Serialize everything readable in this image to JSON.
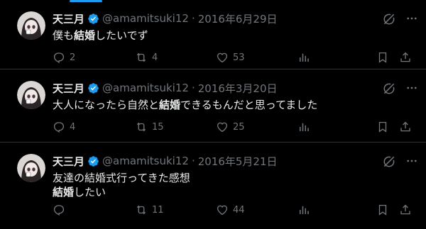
{
  "tweets": [
    {
      "name": "天三月",
      "handle": "@amamitsuki12",
      "separator": "·",
      "date": "2016年6月29日",
      "lines": [
        [
          "僕も",
          "結婚",
          "したいでず"
        ]
      ],
      "replies": "2",
      "retweets": "4",
      "likes": "53"
    },
    {
      "name": "天三月",
      "handle": "@amamitsuki12",
      "separator": "·",
      "date": "2016年3月20日",
      "lines": [
        [
          "大人になったら自然と",
          "結婚",
          "できるもんだと思ってました"
        ]
      ],
      "replies": "4",
      "retweets": "15",
      "likes": "25"
    },
    {
      "name": "天三月",
      "handle": "@amamitsuki12",
      "separator": "·",
      "date": "2016年5月21日",
      "lines": [
        [
          "友達の結婚式行ってきた感想",
          "",
          ""
        ],
        [
          "",
          "結婚",
          "したい"
        ]
      ],
      "replies": "",
      "retweets": "11",
      "likes": "44"
    }
  ],
  "icons": {
    "reply": "reply-icon",
    "retweet": "retweet-icon",
    "like": "heart-icon",
    "views": "analytics-icon",
    "bookmark": "bookmark-icon",
    "share": "share-icon",
    "grok": "grok-icon",
    "more": "more-icon",
    "verified": "verified-badge-icon"
  },
  "colors": {
    "background": "#000000",
    "text": "#e7e9ea",
    "muted": "#71767b",
    "accent": "#1d9bf0",
    "divider": "#2f3336"
  }
}
